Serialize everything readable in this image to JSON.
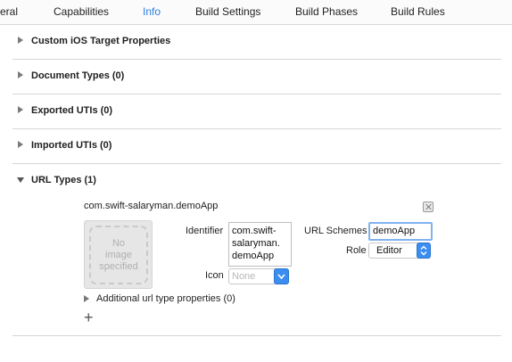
{
  "tabs": [
    {
      "label": "eral"
    },
    {
      "label": "Capabilities"
    },
    {
      "label": "Info"
    },
    {
      "label": "Build Settings"
    },
    {
      "label": "Build Phases"
    },
    {
      "label": "Build Rules"
    }
  ],
  "sections": [
    {
      "title": "Custom iOS Target Properties"
    },
    {
      "title": "Document Types (0)"
    },
    {
      "title": "Exported UTIs (0)"
    },
    {
      "title": "Imported UTIs (0)"
    },
    {
      "title": "URL Types (1)"
    }
  ],
  "url_type": {
    "name": "com.swift-salaryman.demoApp",
    "image_placeholder": [
      "No",
      "image",
      "specified"
    ],
    "identifier_label": "Identifier",
    "identifier_lines": [
      "com.swift-",
      "salaryman.",
      "demoApp"
    ],
    "icon_label": "Icon",
    "icon_placeholder": "None",
    "url_schemes_label": "URL Schemes",
    "url_schemes_value": "demoApp",
    "role_label": "Role",
    "role_value": "Editor",
    "additional_label": "Additional url type properties (0)"
  }
}
